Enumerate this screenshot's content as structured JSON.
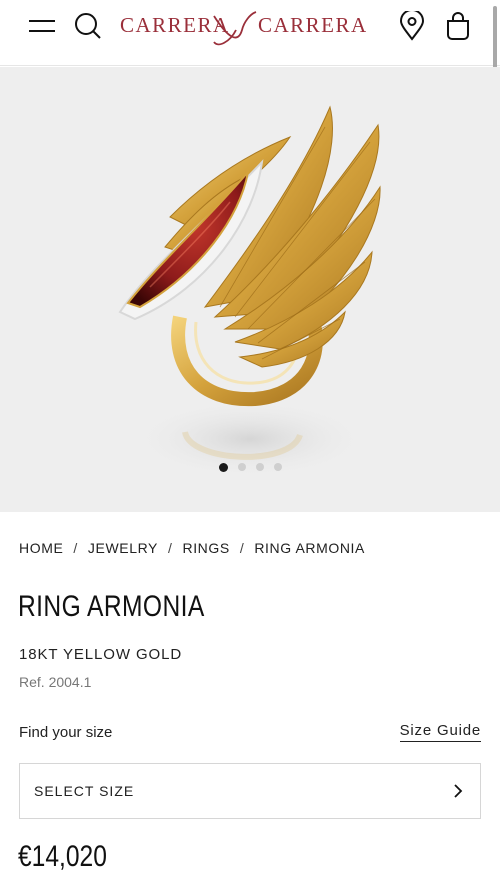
{
  "header": {
    "brand_left": "CARRERA",
    "brand_right": "CARRERA",
    "icons": [
      "menu-icon",
      "search-icon",
      "store-locator-icon",
      "shopping-bag-icon"
    ]
  },
  "gallery": {
    "image_count": 4,
    "active_index": 0
  },
  "breadcrumb": {
    "items": [
      "HOME",
      "JEWELRY",
      "RINGS",
      "RING ARMONIA"
    ],
    "separator": "/"
  },
  "product": {
    "title": "RING ARMONIA",
    "material": "18KT YELLOW GOLD",
    "reference": "Ref. 2004.1",
    "price": "€14,020"
  },
  "size": {
    "find_label": "Find your size",
    "guide_label": "Size Guide",
    "select_label": "SELECT SIZE"
  },
  "colors": {
    "brand": "#9a2f3a",
    "text": "#1a1a1a",
    "gallery_bg": "#eeeeee",
    "stone": "#8e1b1b",
    "gold": "#d4a23c"
  }
}
